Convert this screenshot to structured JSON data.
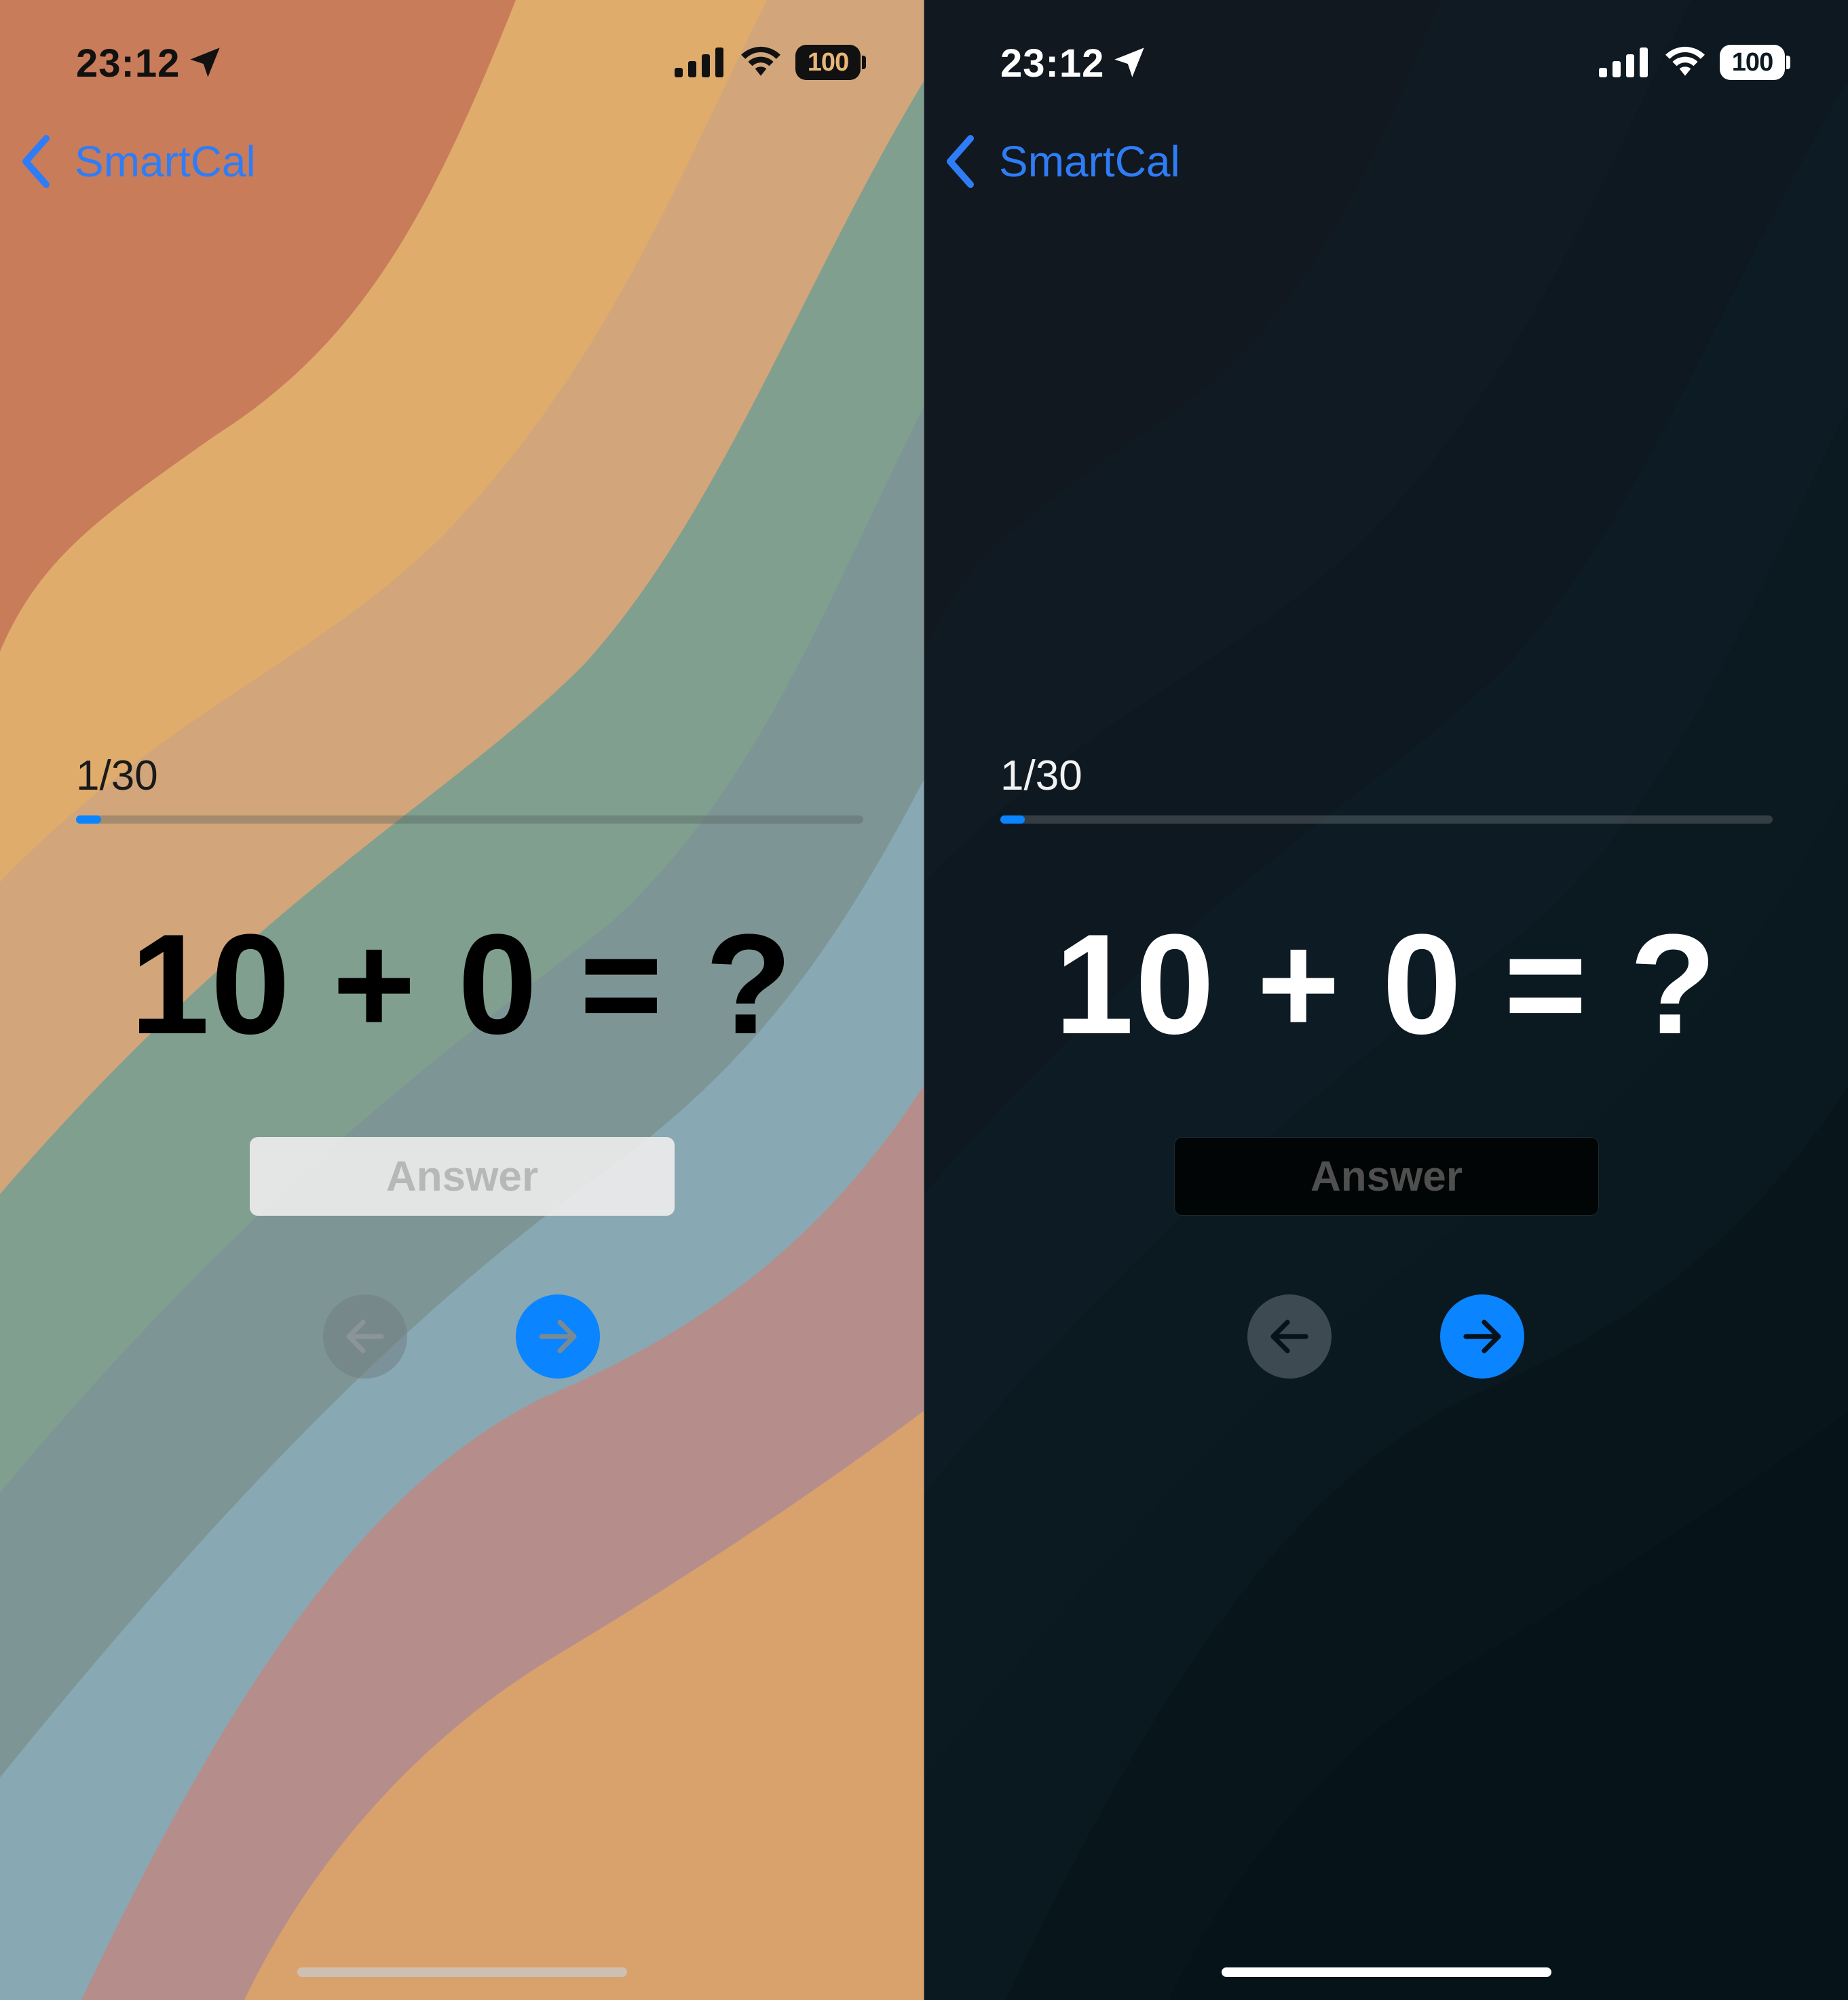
{
  "colors": {
    "accent": "#0a84ff",
    "link": "#2f7df6",
    "light_wave_colors": [
      "#c87c5a",
      "#dfac6c",
      "#cfa87a",
      "#7f9f90",
      "#7e9595",
      "#88a8b3",
      "#b58e8c",
      "#d9a26c"
    ],
    "dark_background": "#0b1a22"
  },
  "screens": [
    {
      "theme": "light",
      "status_bar": {
        "time": "23:12",
        "battery": "100",
        "icons": [
          "location-arrow-icon",
          "cellular-signal-icon",
          "wifi-icon",
          "battery-icon"
        ]
      },
      "nav": {
        "back_label": "SmartCal",
        "back_icon": "chevron-left-icon"
      },
      "progress": {
        "label": "1/30",
        "current": 1,
        "total": 30
      },
      "question": {
        "equation": "10 + 0 = ?"
      },
      "answer": {
        "placeholder": "Answer",
        "value": ""
      },
      "buttons": {
        "prev_icon": "arrow-left-icon",
        "next_icon": "arrow-right-icon"
      }
    },
    {
      "theme": "dark",
      "status_bar": {
        "time": "23:12",
        "battery": "100",
        "icons": [
          "location-arrow-icon",
          "cellular-signal-icon",
          "wifi-icon",
          "battery-icon"
        ]
      },
      "nav": {
        "back_label": "SmartCal",
        "back_icon": "chevron-left-icon"
      },
      "progress": {
        "label": "1/30",
        "current": 1,
        "total": 30
      },
      "question": {
        "equation": "10 + 0 = ?"
      },
      "answer": {
        "placeholder": "Answer",
        "value": ""
      },
      "buttons": {
        "prev_icon": "arrow-left-icon",
        "next_icon": "arrow-right-icon"
      }
    }
  ]
}
